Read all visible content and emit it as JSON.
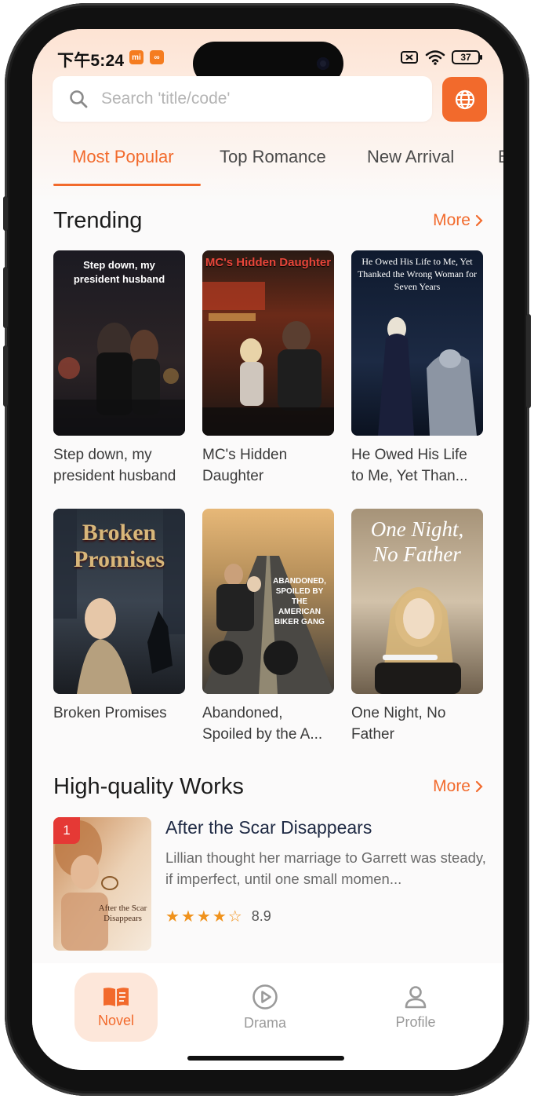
{
  "status_bar": {
    "time": "下午5:24",
    "mini_badge_1": "mi",
    "mini_badge_2": "∞",
    "battery": "37"
  },
  "search": {
    "placeholder": "Search 'title/code'",
    "globe_icon": "globe-icon"
  },
  "tabs": [
    {
      "label": "Most Popular",
      "active": true
    },
    {
      "label": "Top Romance",
      "active": false
    },
    {
      "label": "New Arrival",
      "active": false
    },
    {
      "label": "B",
      "active": false
    }
  ],
  "trending": {
    "title": "Trending",
    "more": "More",
    "books": [
      {
        "title": "Step down, my president husband",
        "cover_text": "Step down, my president husband"
      },
      {
        "title": "MC's Hidden Daughter",
        "cover_text": "MC's Hidden Daughter"
      },
      {
        "title": "He Owed His Life to Me, Yet Than...",
        "cover_text": "He Owed His Life to Me, Yet Thanked the Wrong Woman for Seven Years"
      },
      {
        "title": "Broken Promises",
        "cover_text": "Broken Promises"
      },
      {
        "title": "Abandoned, Spoiled by the A...",
        "cover_text": "ABANDONED, SPOILED BY THE AMERICAN BIKER GANG"
      },
      {
        "title": "One Night, No Father",
        "cover_text": "One Night, No Father"
      }
    ]
  },
  "high_quality": {
    "title": "High-quality Works",
    "more": "More",
    "featured": {
      "rank": "1",
      "title": "After the Scar Disappears",
      "description": "Lillian thought her marriage to Garrett was steady, if imperfect, until one small momen...",
      "cover_text": "After the Scar Disappears",
      "rating": "8.9",
      "stars": 4
    }
  },
  "bottom_nav": [
    {
      "label": "Novel",
      "icon": "book-icon",
      "active": true
    },
    {
      "label": "Drama",
      "icon": "play-circle-icon",
      "active": false
    },
    {
      "label": "Profile",
      "icon": "person-icon",
      "active": false
    }
  ],
  "colors": {
    "accent": "#f26a2c",
    "badge_red": "#e53935",
    "star": "#f0921c"
  }
}
